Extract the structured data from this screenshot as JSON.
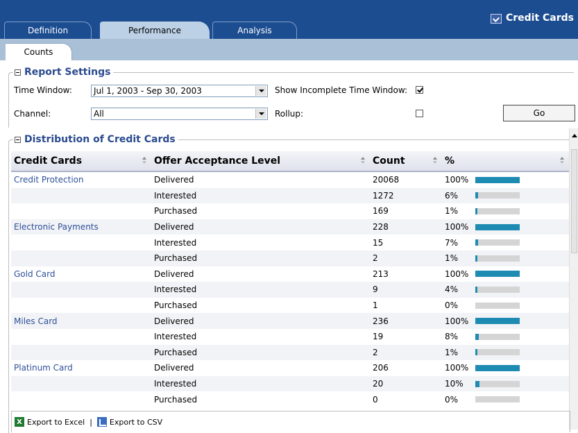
{
  "header": {
    "title": "Credit Cards",
    "tabs": [
      {
        "label": "Definition"
      },
      {
        "label": "Performance"
      },
      {
        "label": "Analysis"
      }
    ],
    "subtab": "Counts"
  },
  "settings": {
    "legend": "Report Settings",
    "time_window_label": "Time Window:",
    "time_window_value": "Jul 1, 2003 - Sep 30, 2003",
    "show_incomplete_label": "Show Incomplete Time Window:",
    "show_incomplete_checked": true,
    "channel_label": "Channel:",
    "channel_value": "All",
    "rollup_label": "Rollup:",
    "rollup_checked": false,
    "go_label": "Go"
  },
  "distribution": {
    "legend": "Distribution of Credit Cards",
    "columns": [
      "Credit Cards",
      "Offer Acceptance Level",
      "Count",
      "%"
    ],
    "rows": [
      {
        "card": "Credit Protection",
        "level": "Delivered",
        "count": "20068",
        "pct": "100%",
        "frac": 1.0
      },
      {
        "card": "",
        "level": "Interested",
        "count": "1272",
        "pct": "6%",
        "frac": 0.06
      },
      {
        "card": "",
        "level": "Purchased",
        "count": "169",
        "pct": "1%",
        "frac": 0.01
      },
      {
        "card": "Electronic Payments",
        "level": "Delivered",
        "count": "228",
        "pct": "100%",
        "frac": 1.0
      },
      {
        "card": "",
        "level": "Interested",
        "count": "15",
        "pct": "7%",
        "frac": 0.07
      },
      {
        "card": "",
        "level": "Purchased",
        "count": "2",
        "pct": "1%",
        "frac": 0.01
      },
      {
        "card": "Gold Card",
        "level": "Delivered",
        "count": "213",
        "pct": "100%",
        "frac": 1.0
      },
      {
        "card": "",
        "level": "Interested",
        "count": "9",
        "pct": "4%",
        "frac": 0.04
      },
      {
        "card": "",
        "level": "Purchased",
        "count": "1",
        "pct": "0%",
        "frac": 0.0
      },
      {
        "card": "Miles Card",
        "level": "Delivered",
        "count": "236",
        "pct": "100%",
        "frac": 1.0
      },
      {
        "card": "",
        "level": "Interested",
        "count": "19",
        "pct": "8%",
        "frac": 0.08
      },
      {
        "card": "",
        "level": "Purchased",
        "count": "2",
        "pct": "1%",
        "frac": 0.01
      },
      {
        "card": "Platinum Card",
        "level": "Delivered",
        "count": "206",
        "pct": "100%",
        "frac": 1.0
      },
      {
        "card": "",
        "level": "Interested",
        "count": "20",
        "pct": "10%",
        "frac": 0.1
      },
      {
        "card": "",
        "level": "Purchased",
        "count": "0",
        "pct": "0%",
        "frac": 0.0
      }
    ]
  },
  "footer": {
    "export_excel": "Export to Excel",
    "separator": "|",
    "export_csv": "Export to CSV"
  },
  "colors": {
    "header_bg": "#1d4d91",
    "bar_fill": "#1e8bb2",
    "link": "#2d4f99"
  }
}
